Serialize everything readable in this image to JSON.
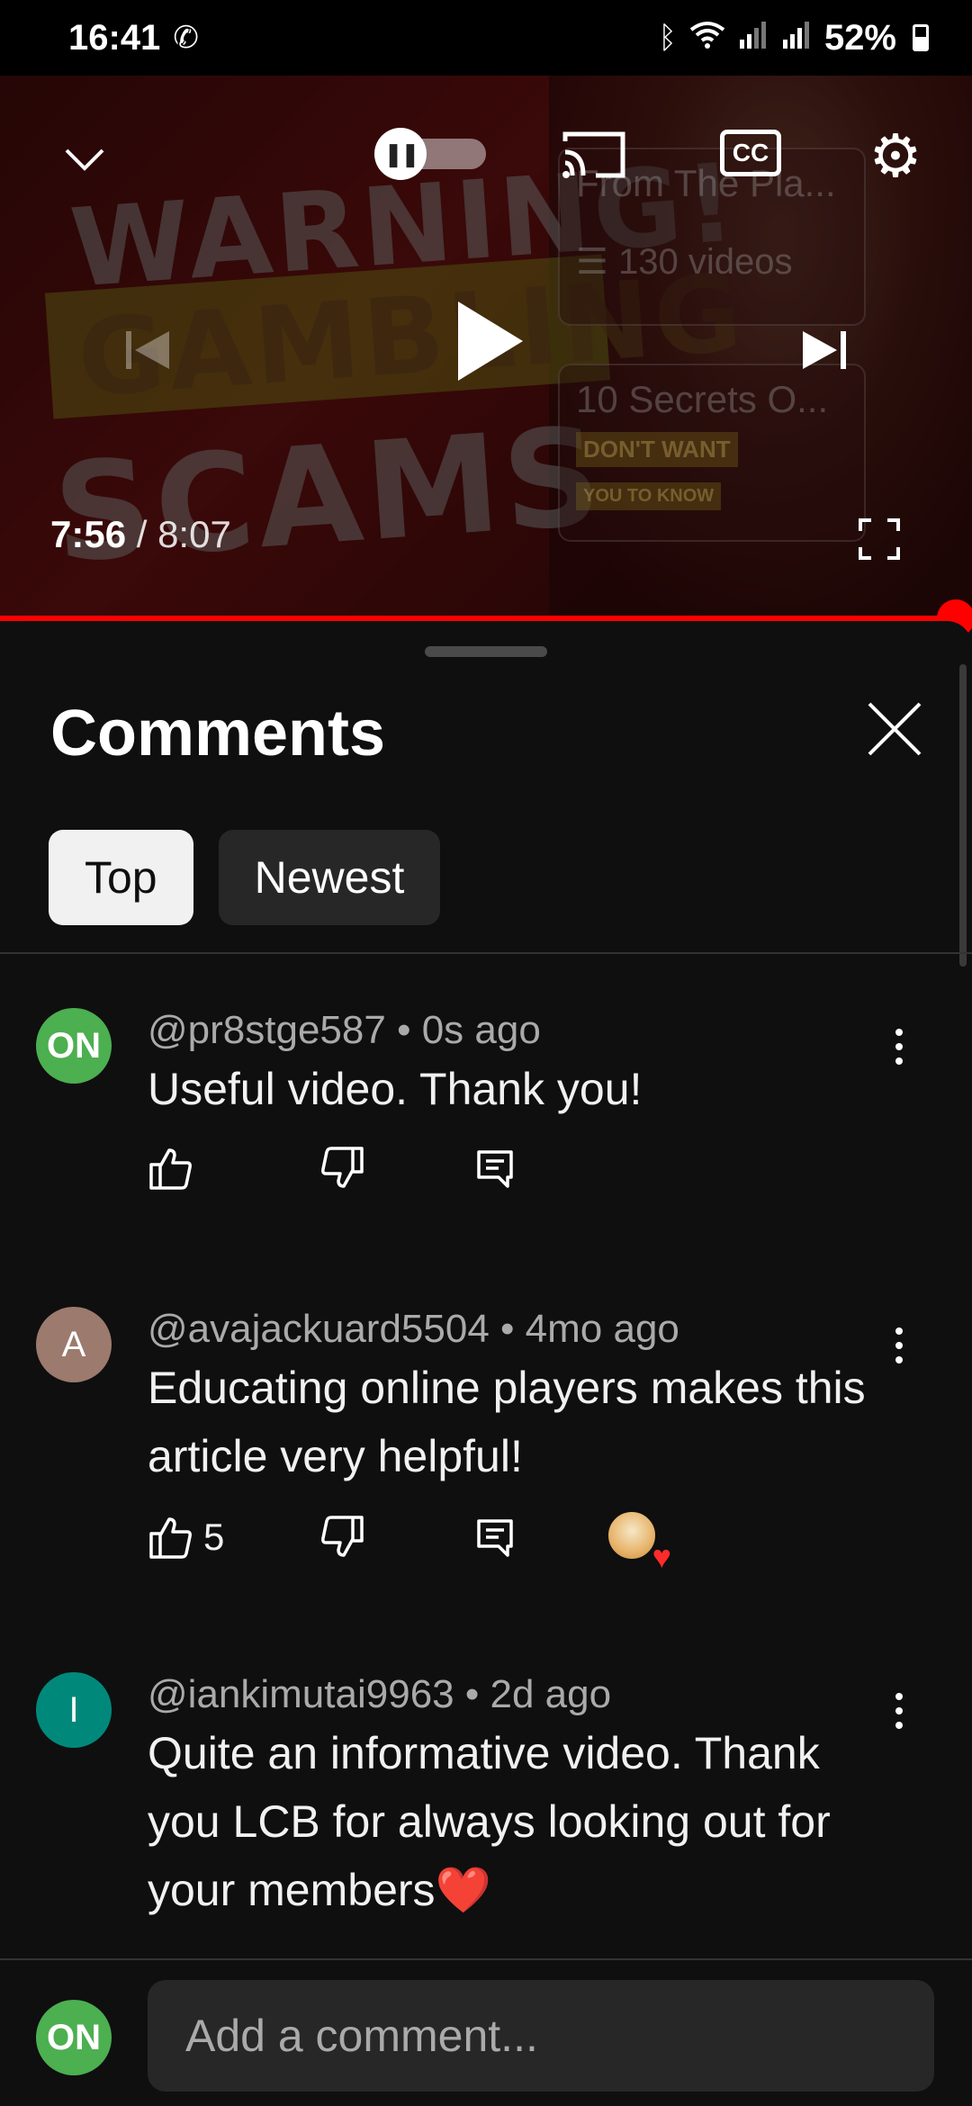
{
  "status_bar": {
    "time": "16:41",
    "battery": "52%",
    "icons": [
      "viber-icon",
      "bluetooth-icon",
      "wifi-icon",
      "signal-icon",
      "signal-icon",
      "battery-icon"
    ]
  },
  "video": {
    "thumbnail_text": {
      "line1": "WARNING!",
      "line2": "GAMBLING",
      "line3": "SCAMS"
    },
    "card1": {
      "title": "From The Pla...",
      "subtitle": "130 videos"
    },
    "card2": {
      "title": "10 Secrets O...",
      "tag1": "DON'T WANT",
      "tag2": "YOU TO KNOW"
    },
    "current_time": "7:56",
    "separator": " / ",
    "duration": "8:07",
    "progress_fraction": 0.983,
    "cc_label": "CC",
    "progress_color": "#ff0000"
  },
  "comments_sheet": {
    "title": "Comments",
    "filters": [
      {
        "label": "Top",
        "active": true
      },
      {
        "label": "Newest",
        "active": false
      }
    ],
    "comments": [
      {
        "avatar_text": "ON",
        "avatar_color": "#4caf50",
        "author": "@pr8stge587",
        "time": "0s ago",
        "text": "Useful video. Thank you!",
        "likes": "",
        "hearted": false
      },
      {
        "avatar_text": "A",
        "avatar_color": "#9c7a6e",
        "author": "@avajackuard5504",
        "time": "4mo ago",
        "text": "Educating online players makes this article very helpful!",
        "likes": "5",
        "hearted": true
      },
      {
        "avatar_text": "I",
        "avatar_color": "#00897b",
        "author": "@iankimutai9963",
        "time": "2d ago",
        "text": "Quite an informative video. Thank you LCB for always looking out for your members❤️",
        "likes": "",
        "hearted": false
      }
    ],
    "meta_separator": " • ",
    "add_comment": {
      "avatar_text": "ON",
      "avatar_color": "#4caf50",
      "placeholder": "Add a comment..."
    }
  }
}
